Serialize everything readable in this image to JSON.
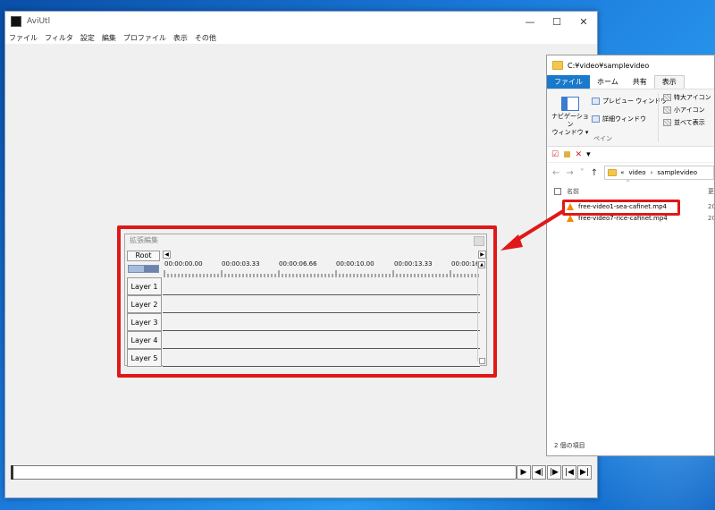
{
  "aviutl": {
    "title": "AviUtl",
    "menu": [
      "ファイル",
      "フィルタ",
      "設定",
      "編集",
      "プロファイル",
      "表示",
      "その他"
    ],
    "window_controls": {
      "minimize": "—",
      "maximize": "☐",
      "close": "✕"
    },
    "transport": [
      "▶",
      "◀|",
      "|▶",
      "|◀",
      "▶|"
    ]
  },
  "exedit": {
    "title": "拡張編集",
    "root_label": "Root",
    "timecodes": [
      "00:00:00.00",
      "00:00:03.33",
      "00:00:06.66",
      "00:00:10.00",
      "00:00:13.33",
      "00:00:16"
    ],
    "layers": [
      "Layer 1",
      "Layer 2",
      "Layer 3",
      "Layer 4",
      "Layer 5"
    ]
  },
  "explorer": {
    "title": "C:¥video¥samplevideo",
    "tabs": {
      "file": "ファイル",
      "home": "ホーム",
      "share": "共有",
      "view": "表示"
    },
    "ribbon": {
      "nav_pane": "ナビゲーション\nウィンドウ ▾",
      "preview_pane": "プレビュー ウィンドウ",
      "details_pane": "詳細ウィンドウ",
      "pane_caption": "ペイン",
      "extra_large": "特大アイコン",
      "small_icons": "小アイコン",
      "tiles": "並べて表示"
    },
    "address": {
      "prefix": "«",
      "crumbs": [
        "video",
        "samplevideo"
      ]
    },
    "header": {
      "name": "名前",
      "date": "更"
    },
    "files": [
      {
        "name": "free-video1-sea-cafinet.mp4",
        "date": "20"
      },
      {
        "name": "free-video7-rice-cafinet.mp4",
        "date": "20"
      }
    ],
    "status": "2 個の項目"
  }
}
